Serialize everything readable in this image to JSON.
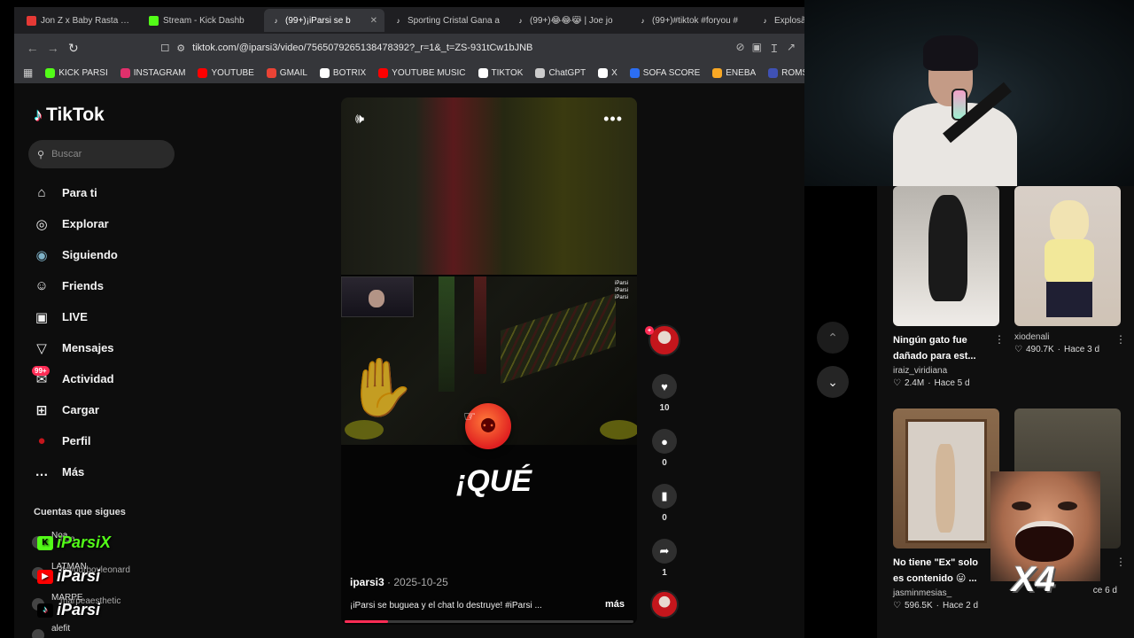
{
  "browser": {
    "tabs": [
      {
        "label": "Jon Z x Baby Rasta x Bo",
        "icon_color": "#e53935"
      },
      {
        "label": "Stream - Kick Dashb",
        "icon_color": "#53fc18"
      },
      {
        "label": "(99+)¡iParsi se b",
        "icon_color": "#ffffff",
        "active": true
      },
      {
        "label": "Sporting Cristal Gana a",
        "icon_color": "#ffffff"
      },
      {
        "label": "(99+)😂😂😹 | Joe jo",
        "icon_color": "#ffffff"
      },
      {
        "label": "(99+)#tiktok #foryou #",
        "icon_color": "#ffffff"
      },
      {
        "label": "Explosã",
        "icon_color": "#ffffff"
      }
    ],
    "url": "tiktok.com/@iparsi3/video/7565079265138478392?_r=1&_t=ZS-931tCw1bJNB",
    "bookmarks": [
      {
        "label": "KICK PARSI",
        "color": "#53fc18"
      },
      {
        "label": "INSTAGRAM",
        "color": "#e1306c"
      },
      {
        "label": "YOUTUBE",
        "color": "#ff0000"
      },
      {
        "label": "GMAIL",
        "color": "#ea4335"
      },
      {
        "label": "BOTRIX",
        "color": "#ffffff"
      },
      {
        "label": "YOUTUBE MUSIC",
        "color": "#ff0000"
      },
      {
        "label": "TIKTOK",
        "color": "#ffffff"
      },
      {
        "label": "ChatGPT",
        "color": "#cccccc"
      },
      {
        "label": "X",
        "color": "#ffffff"
      },
      {
        "label": "SOFA SCORE",
        "color": "#2c6ef2"
      },
      {
        "label": "ENEBA",
        "color": "#f9a825"
      },
      {
        "label": "ROMSFUN",
        "color": "#3f51b5"
      }
    ]
  },
  "sidebar": {
    "brand": "TikTok",
    "search_placeholder": "Buscar",
    "items": [
      {
        "label": "Para ti",
        "icon": "home-icon"
      },
      {
        "label": "Explorar",
        "icon": "compass-icon"
      },
      {
        "label": "Siguiendo",
        "icon": "following-avatar-icon"
      },
      {
        "label": "Friends",
        "icon": "friends-icon"
      },
      {
        "label": "LIVE",
        "icon": "live-tv-icon"
      },
      {
        "label": "Mensajes",
        "icon": "inbox-icon"
      },
      {
        "label": "Actividad",
        "icon": "activity-icon",
        "badge": "99+"
      },
      {
        "label": "Cargar",
        "icon": "upload-icon"
      },
      {
        "label": "Perfil",
        "icon": "profile-avatar-icon"
      },
      {
        "label": "Más",
        "icon": "more-dots-icon"
      }
    ],
    "following_title": "Cuentas que sigues",
    "following": [
      {
        "name": "Noa",
        "sub": "noa"
      },
      {
        "name": "LATMAN",
        "sub": "itsyourboyleonard"
      },
      {
        "name": "MARPE",
        "sub": "marpeaesthetic"
      },
      {
        "name": "alefit",
        "sub": ""
      }
    ],
    "overlay_tags": [
      {
        "label": "iParsiX",
        "color": "#53fc18"
      },
      {
        "label": "iParsi",
        "color": "#ff0000"
      },
      {
        "label": "iParsi",
        "color": "#000000"
      }
    ]
  },
  "video": {
    "author": "iparsi3",
    "date": "· 2025-10-25",
    "description": "¡iParsi se buguea y el chat lo destruye! #iParsi ...",
    "more_label": "más",
    "caption_text": "¡QUÉ",
    "watermark": [
      "iParsi",
      "iParsi",
      "iParsi"
    ],
    "progress": 0.15
  },
  "actions": {
    "likes": "10",
    "comments": "0",
    "saves": "0",
    "shares": "1"
  },
  "recommended": [
    {
      "title": "Ningún gato fue dañado para est...",
      "author": "iraiz_viridiana",
      "views": "2.4M",
      "age": "Hace 5 d"
    },
    {
      "title": "",
      "author": "xiodenali",
      "views": "490.7K",
      "age": "Hace 3 d"
    },
    {
      "title": "No tiene \"Ex\" solo es contenido 😛 ...",
      "author": "jasminmesias_",
      "views": "596.5K",
      "age": "Hace 2 d"
    },
    {
      "title": "",
      "author": "",
      "views": "",
      "age": "ce 6 d"
    }
  ],
  "overlay": {
    "meme_text": "X4"
  }
}
